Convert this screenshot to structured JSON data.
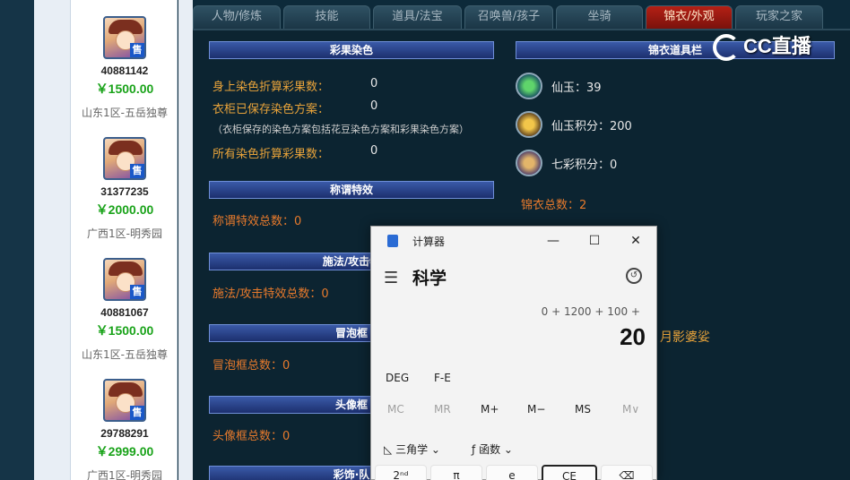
{
  "sellers": [
    {
      "id": "40881142",
      "price": "￥1500.00",
      "server": "山东1区-五岳独尊",
      "badge": "售"
    },
    {
      "id": "31377235",
      "price": "￥2000.00",
      "server": "广西1区-明秀园",
      "badge": "售"
    },
    {
      "id": "40881067",
      "price": "￥1500.00",
      "server": "山东1区-五岳独尊",
      "badge": "售"
    },
    {
      "id": "29788291",
      "price": "￥2999.00",
      "server": "广西1区-明秀园",
      "badge": "售"
    }
  ],
  "tabs": [
    "人物/修炼",
    "技能",
    "道具/法宝",
    "召唤兽/孩子",
    "坐骑",
    "锦衣/外观",
    "玩家之家"
  ],
  "active_tab": "锦衣/外观",
  "sections": {
    "dye": {
      "title": "彩果染色",
      "line1_label": "身上染色折算彩果数：",
      "line1_value": "0",
      "line2_label": "衣柜已保存染色方案：",
      "line2_value": "0",
      "note": "（衣柜保存的染色方案包括花豆染色方案和彩果染色方案）",
      "line3_label": "所有染色折算彩果数：",
      "line3_value": "0"
    },
    "title_effect": {
      "title": "称谓特效",
      "text": "称谓特效总数：0"
    },
    "cast_effect": {
      "title": "施法/攻击特",
      "text": "施法/攻击特效总数：0"
    },
    "bubble": {
      "title": "冒泡框",
      "text": "冒泡框总数：0"
    },
    "avatar_frame": {
      "title": "头像框",
      "text": "头像框总数：0"
    },
    "decor": {
      "title": "彩饰·队"
    },
    "wardrobe": {
      "title": "锦衣道具栏",
      "xianyu": "仙玉：39",
      "xianyu_points": "仙玉积分：200",
      "qicai_points": "七彩积分：0",
      "total": "锦衣总数：2"
    },
    "side_note": "月影婆娑"
  },
  "watermark": "CC直播",
  "calculator": {
    "title": "计算器",
    "mode": "科学",
    "expression": "0 + 1200 + 100 +",
    "result": "20",
    "deg": "DEG",
    "fe": "F-E",
    "memory": [
      "MC",
      "MR",
      "M+",
      "M−",
      "MS",
      "M∨"
    ],
    "trig": "三角学",
    "func": "函数",
    "keys": [
      "2ⁿᵈ",
      "π",
      "e",
      "CE",
      "⌫"
    ],
    "window_controls": {
      "min": "—",
      "max": "☐",
      "close": "✕"
    }
  }
}
